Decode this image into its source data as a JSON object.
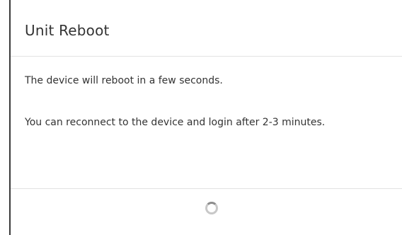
{
  "dialog": {
    "title": "Unit Reboot",
    "messages": [
      "The device will reboot in a few seconds.",
      "You can reconnect to the device and login after 2-3 minutes."
    ]
  },
  "footer": {
    "spinner_icon": "loading-spinner-icon"
  },
  "colors": {
    "text": "#333333",
    "divider": "#e2e2e2",
    "spinner": "#8d8d8d"
  }
}
